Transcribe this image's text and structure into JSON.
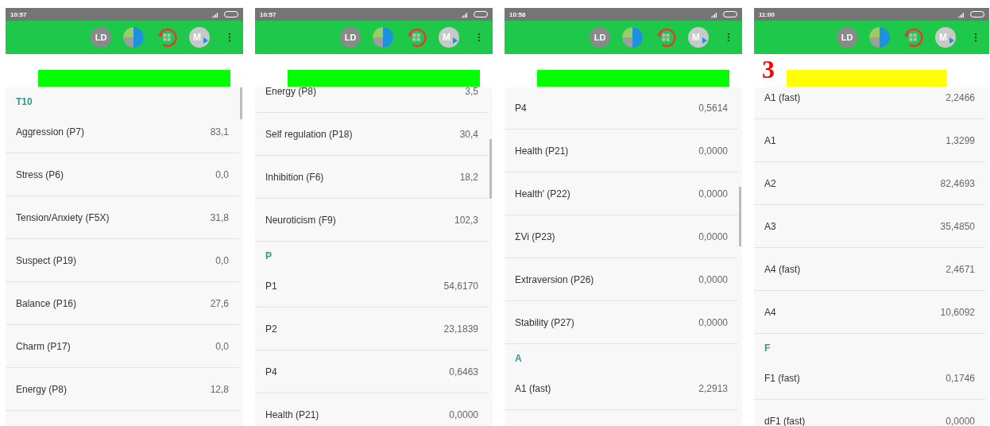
{
  "screens": [
    {
      "status_bar": {
        "time": "10:57"
      },
      "toolbar": {
        "avatar": "LD",
        "profile": "M"
      },
      "highlight": {
        "color": "#00ff00"
      },
      "list": [
        {
          "kind": "header",
          "label": "T10"
        },
        {
          "kind": "row",
          "label": "Aggression (P7)",
          "value": "83,1"
        },
        {
          "kind": "row",
          "label": "Stress (P6)",
          "value": "0,0"
        },
        {
          "kind": "row",
          "label": "Tension/Anxiety (F5X)",
          "value": "31,8"
        },
        {
          "kind": "row",
          "label": "Suspect (P19)",
          "value": "0,0"
        },
        {
          "kind": "row",
          "label": "Balance (P16)",
          "value": "27,6"
        },
        {
          "kind": "row",
          "label": "Charm (P17)",
          "value": "0,0"
        },
        {
          "kind": "row",
          "label": "Energy (P8)",
          "value": "12,8"
        }
      ]
    },
    {
      "status_bar": {
        "time": "10:57"
      },
      "toolbar": {
        "avatar": "LD",
        "profile": "M"
      },
      "highlight": {
        "color": "#00ff00"
      },
      "list": [
        {
          "kind": "row",
          "label": "Energy (P8)",
          "value": "3,5"
        },
        {
          "kind": "row",
          "label": "Self regulation (P18)",
          "value": "30,4"
        },
        {
          "kind": "row",
          "label": "Inhibition (F6)",
          "value": "18,2"
        },
        {
          "kind": "row",
          "label": "Neuroticism (F9)",
          "value": "102,3"
        },
        {
          "kind": "header",
          "label": "P"
        },
        {
          "kind": "row",
          "label": "P1",
          "value": "54,6170"
        },
        {
          "kind": "row",
          "label": "P2",
          "value": "23,1839"
        },
        {
          "kind": "row",
          "label": "P4",
          "value": "0,6463"
        },
        {
          "kind": "row",
          "label": "Health (P21)",
          "value": "0,0000"
        }
      ]
    },
    {
      "status_bar": {
        "time": "10:58"
      },
      "toolbar": {
        "avatar": "LD",
        "profile": "M"
      },
      "highlight": {
        "color": "#00ff00"
      },
      "list": [
        {
          "kind": "row",
          "label": "P4",
          "value": "0,5614"
        },
        {
          "kind": "row",
          "label": "Health (P21)",
          "value": "0,0000"
        },
        {
          "kind": "row",
          "label": "Health' (P22)",
          "value": "0,0000"
        },
        {
          "kind": "row",
          "label": "ΣVi (P23)",
          "value": "0,0000"
        },
        {
          "kind": "row",
          "label": "Extraversion (P26)",
          "value": "0,0000"
        },
        {
          "kind": "row",
          "label": "Stability (P27)",
          "value": "0,0000"
        },
        {
          "kind": "header",
          "label": "A"
        },
        {
          "kind": "row",
          "label": "A1 (fast)",
          "value": "2,2913"
        }
      ]
    },
    {
      "status_bar": {
        "time": "11:00"
      },
      "toolbar": {
        "avatar": "LD",
        "profile": "M"
      },
      "marker": "3",
      "highlight": {
        "color": "#ffff00"
      },
      "list": [
        {
          "kind": "row",
          "label": "A1 (fast)",
          "value": "2,2466"
        },
        {
          "kind": "row",
          "label": "A1",
          "value": "1,3299"
        },
        {
          "kind": "row",
          "label": "A2",
          "value": "82,4693"
        },
        {
          "kind": "row",
          "label": "A3",
          "value": "35,4850"
        },
        {
          "kind": "row",
          "label": "A4 (fast)",
          "value": "2,4671"
        },
        {
          "kind": "row",
          "label": "A4",
          "value": "10,6092"
        },
        {
          "kind": "header",
          "label": "F"
        },
        {
          "kind": "row",
          "label": "F1 (fast)",
          "value": "0,1746"
        },
        {
          "kind": "row",
          "label": "dF1 (fast)",
          "value": "0,0000"
        }
      ]
    }
  ]
}
